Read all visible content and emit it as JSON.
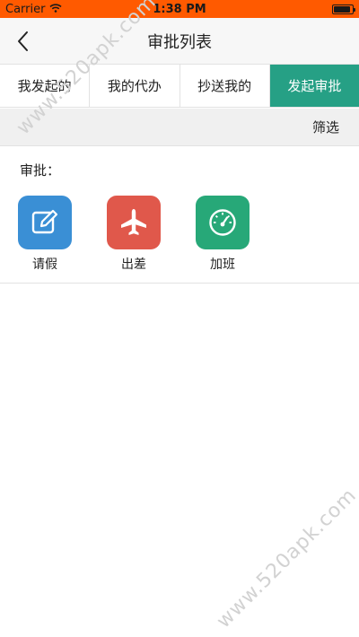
{
  "status_bar": {
    "carrier": "Carrier",
    "time": "1:38 PM",
    "battery_level": 0.9
  },
  "nav": {
    "title": "审批列表",
    "back_icon": "chevron-left-icon"
  },
  "tabs": [
    {
      "label": "我发起的",
      "active": false
    },
    {
      "label": "我的代办",
      "active": false
    },
    {
      "label": "抄送我的",
      "active": false
    },
    {
      "label": "发起审批",
      "active": true
    }
  ],
  "filter": {
    "label": "筛选"
  },
  "approval": {
    "section_label": "审批：",
    "items": [
      {
        "label": "请假",
        "icon": "edit-icon",
        "color": "#3a8fd5"
      },
      {
        "label": "出差",
        "icon": "airplane-icon",
        "color": "#e0584b"
      },
      {
        "label": "加班",
        "icon": "gauge-icon",
        "color": "#27a878"
      }
    ]
  },
  "watermarks": [
    "www.520apk.com",
    "www.520apk.com"
  ],
  "colors": {
    "status_bar": "#ff5a00",
    "accent": "#26a085"
  }
}
